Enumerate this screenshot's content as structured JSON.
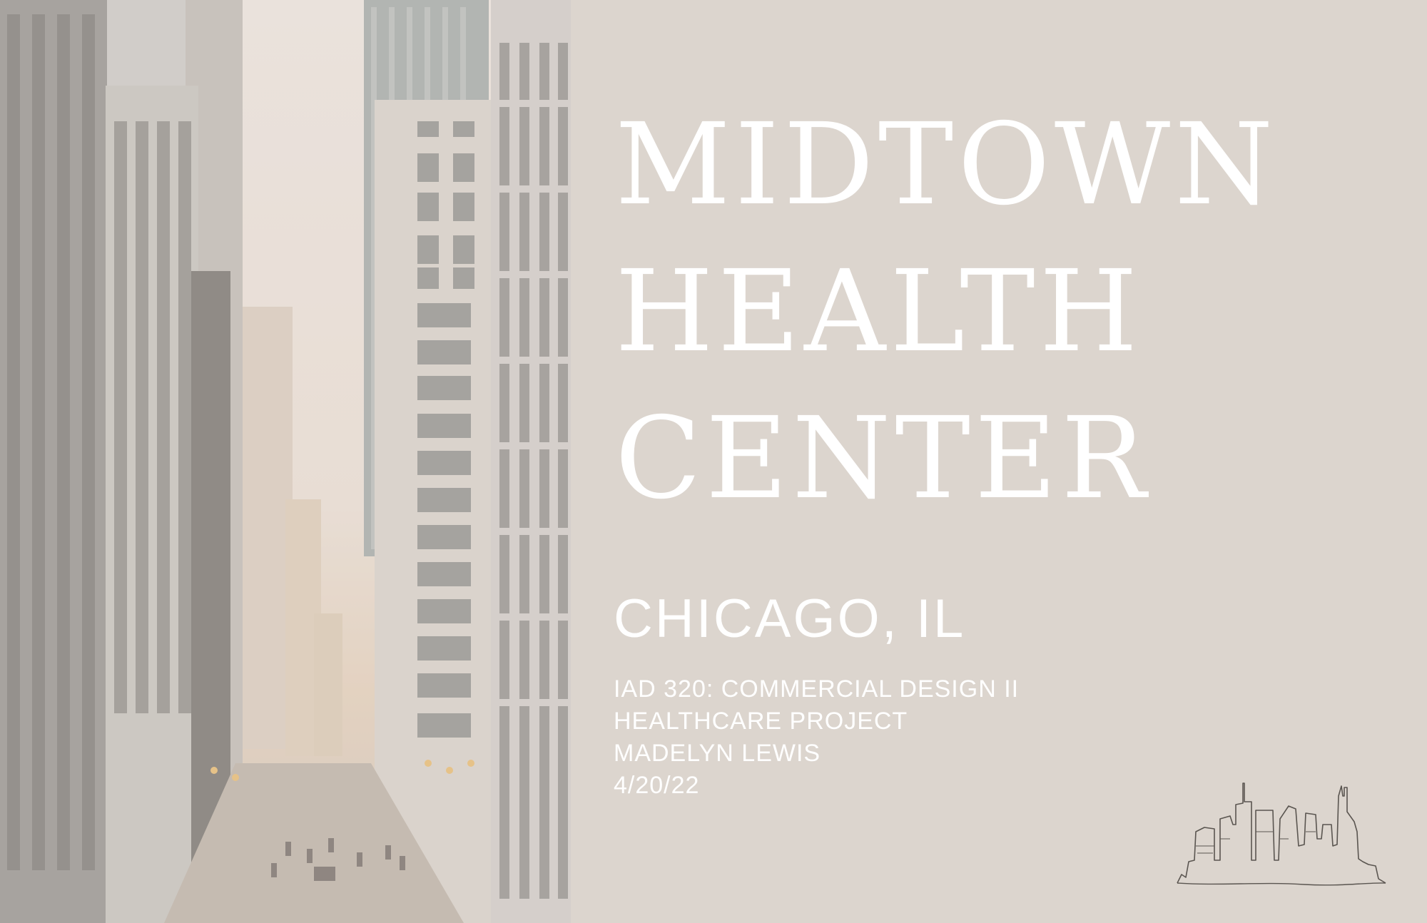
{
  "cover": {
    "title_lines": [
      "MIDTOWN",
      "HEALTH",
      "CENTER"
    ],
    "location": "CHICAGO, IL",
    "details": [
      "IAD 320: COMMERCIAL DESIGN II",
      "HEALTHCARE PROJECT",
      "MADELYN LEWIS",
      "4/20/22"
    ]
  },
  "images": {
    "photo": "city-street-photo",
    "skyline": "skyline-line-icon"
  },
  "colors": {
    "background": "#dcd5ce",
    "text": "#ffffff",
    "skyline_stroke": "#5a5550"
  }
}
